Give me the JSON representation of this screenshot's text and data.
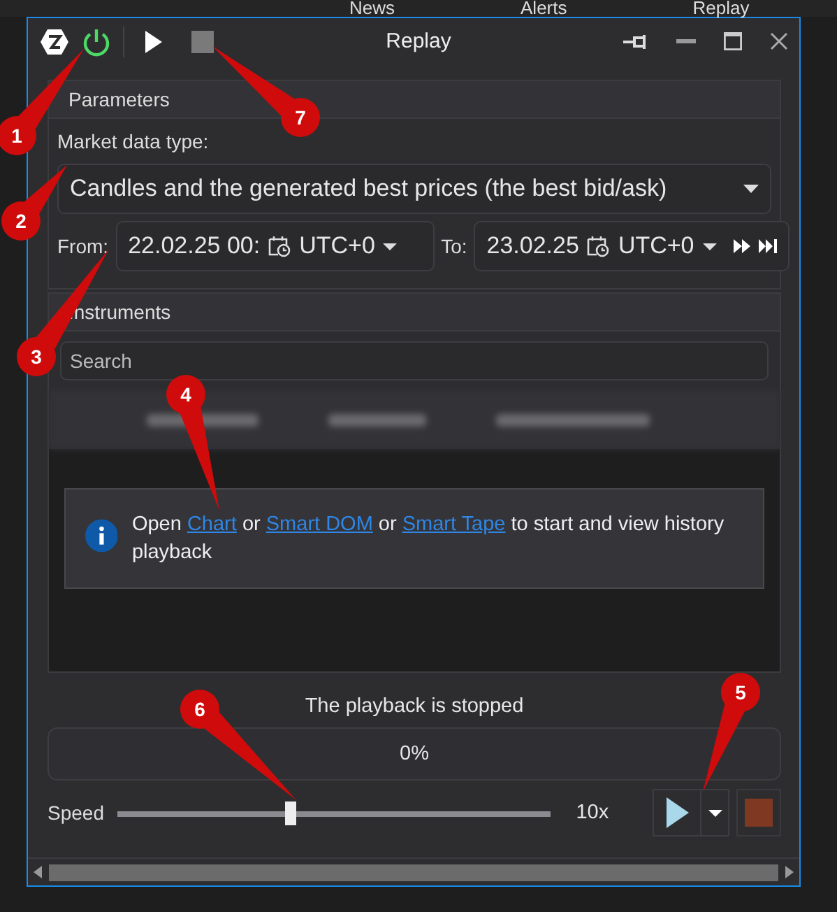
{
  "background_toolbar": [
    {
      "label": "News"
    },
    {
      "label": "Alerts"
    },
    {
      "label": "Replay"
    }
  ],
  "window": {
    "title": "Replay",
    "connected": true
  },
  "parameters": {
    "title": "Parameters",
    "market_data_label": "Market data type:",
    "market_data_type": "Candles and the generated best prices (the best bid/ask)",
    "from_label": "From:",
    "from_value": "22.02.25 00:",
    "from_zone": "UTC+0",
    "to_label": "To:",
    "to_value": "23.02.25",
    "to_zone": "UTC+0"
  },
  "instruments": {
    "title": "Instruments",
    "search_placeholder": "Search",
    "message": [
      {
        "text": "Open "
      },
      {
        "text": "Chart",
        "link": true
      },
      {
        "text": " or "
      },
      {
        "text": "Smart DOM",
        "link": true
      },
      {
        "text": " or "
      },
      {
        "text": "Smart Tape",
        "link": true
      },
      {
        "text": " to start and view history playback"
      }
    ]
  },
  "status": "The playback is stopped",
  "progress": {
    "level": 0,
    "reading": "0%"
  },
  "speed": {
    "label": "Speed",
    "level": 0.4,
    "reading": "10x"
  },
  "playing": false,
  "callouts": [
    {
      "label": "1"
    },
    {
      "label": "7"
    },
    {
      "label": "2"
    },
    {
      "label": "3"
    },
    {
      "label": "4"
    },
    {
      "label": "6"
    },
    {
      "label": "5"
    }
  ]
}
